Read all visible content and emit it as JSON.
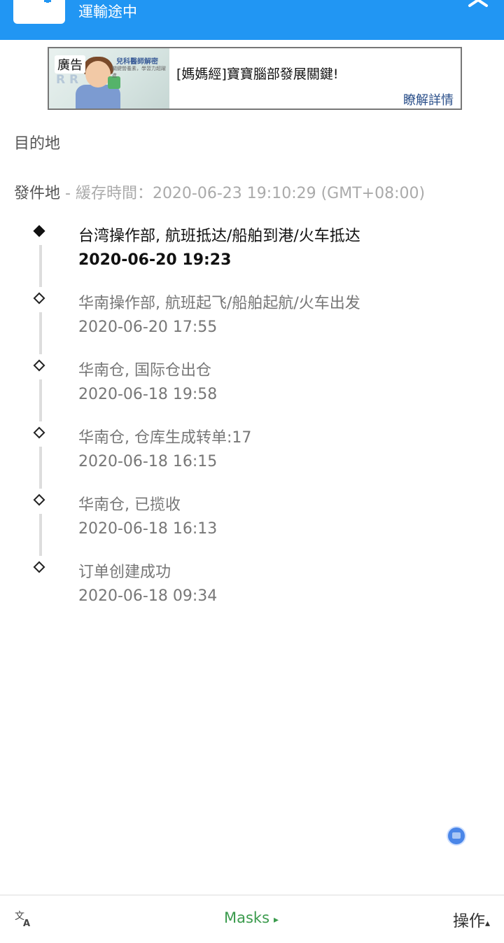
{
  "header": {
    "title": "運輸途中",
    "accent_color": "#2196f3",
    "icons": [
      "airplane-icon",
      "close-icon"
    ]
  },
  "ad": {
    "label": "廣告",
    "headline": "[媽媽經]寶寶腦部發展關鍵!",
    "cta": "瞭解詳情",
    "image_brand": "兒科醫師解密",
    "image_tagline": "關鍵營養素，學習力超躍進",
    "image_letters": "R R"
  },
  "destination": {
    "label": "目的地"
  },
  "origin": {
    "label": "發件地",
    "cache_text": " - 緩存時間：2020-06-23 19:10:29 (GMT+08:00)"
  },
  "events": [
    {
      "desc": "台湾操作部, 航班抵达/船舶到港/火车抵达",
      "time": "2020-06-20 19:23",
      "current": true
    },
    {
      "desc": "华南操作部, 航班起飞/船舶起航/火车出发",
      "time": "2020-06-20 17:55",
      "current": false
    },
    {
      "desc": "华南仓, 国际仓出仓",
      "time": "2020-06-18 19:58",
      "current": false
    },
    {
      "desc": "华南仓, 仓库生成转单:17",
      "time": "2020-06-18 16:15",
      "current": false
    },
    {
      "desc": "华南仓, 已揽收",
      "time": "2020-06-18 16:13",
      "current": false
    },
    {
      "desc": "订单创建成功",
      "time": "2020-06-18 09:34",
      "current": false
    }
  ],
  "bottom_bar": {
    "translate_icon": "translate-icon",
    "masks_label": "Masks",
    "masks_arrow": "▸",
    "ops_label": "操作",
    "ops_arrow": "▴",
    "masks_color": "#3b9b4d"
  }
}
